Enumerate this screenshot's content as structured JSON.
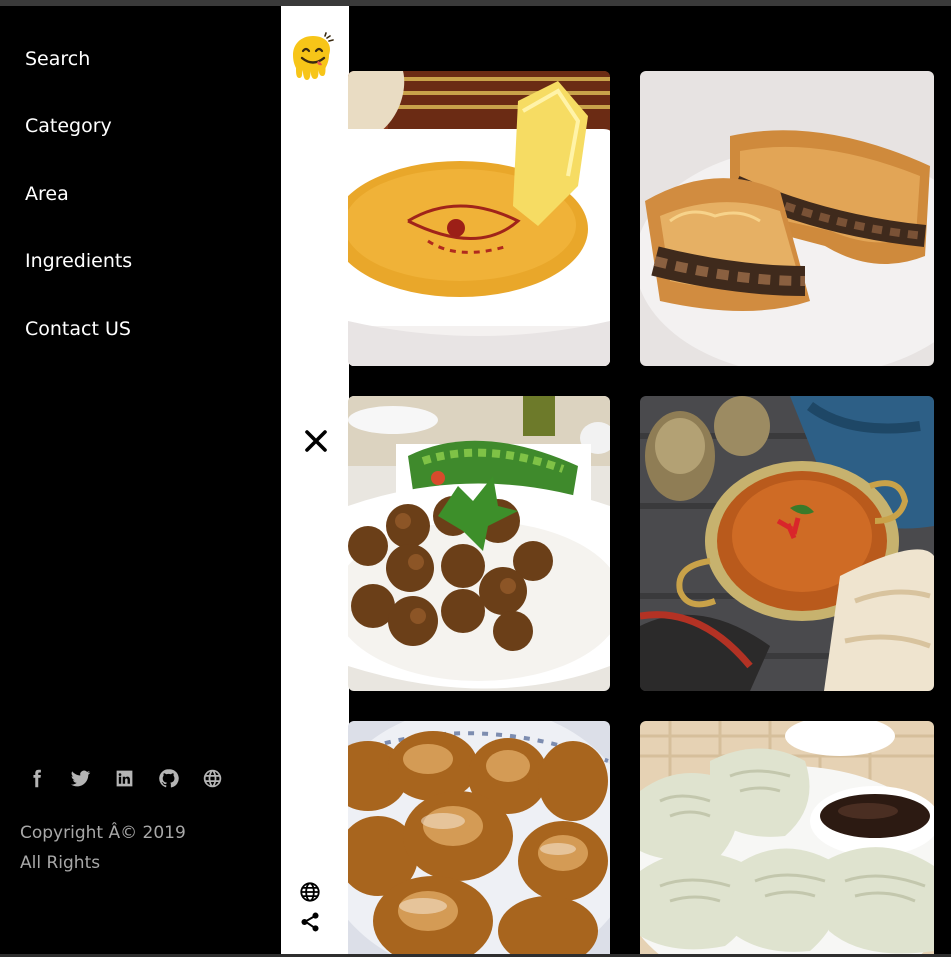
{
  "nav": {
    "items": [
      {
        "label": "Search"
      },
      {
        "label": "Category"
      },
      {
        "label": "Area"
      },
      {
        "label": "Ingredients"
      },
      {
        "label": "Contact US"
      }
    ]
  },
  "social": [
    "facebook-icon",
    "twitter-icon",
    "linkedin-icon",
    "github-icon",
    "globe-icon"
  ],
  "footer": {
    "copyright_line1": "Copyright Â© 2019",
    "copyright_line2": "All Rights"
  },
  "strip": {
    "logo": "yummy-face-logo",
    "toggle": "close-icon",
    "bottom_icons": [
      "globe-icon",
      "share-icon"
    ]
  },
  "meals": [
    {
      "image": "lentil-soup-with-lemon"
    },
    {
      "image": "meat-borek-pastry"
    },
    {
      "image": "falafel-with-salad"
    },
    {
      "image": "tomato-soup-in-copper-pot"
    },
    {
      "image": "sugared-fried-dough"
    },
    {
      "image": "dumplings-with-soy-sauce"
    }
  ],
  "colors": {
    "background": "#000000",
    "strip": "#ffffff",
    "text": "#ffffff",
    "muted": "#a8a8a8",
    "logo": "#f7c518"
  }
}
